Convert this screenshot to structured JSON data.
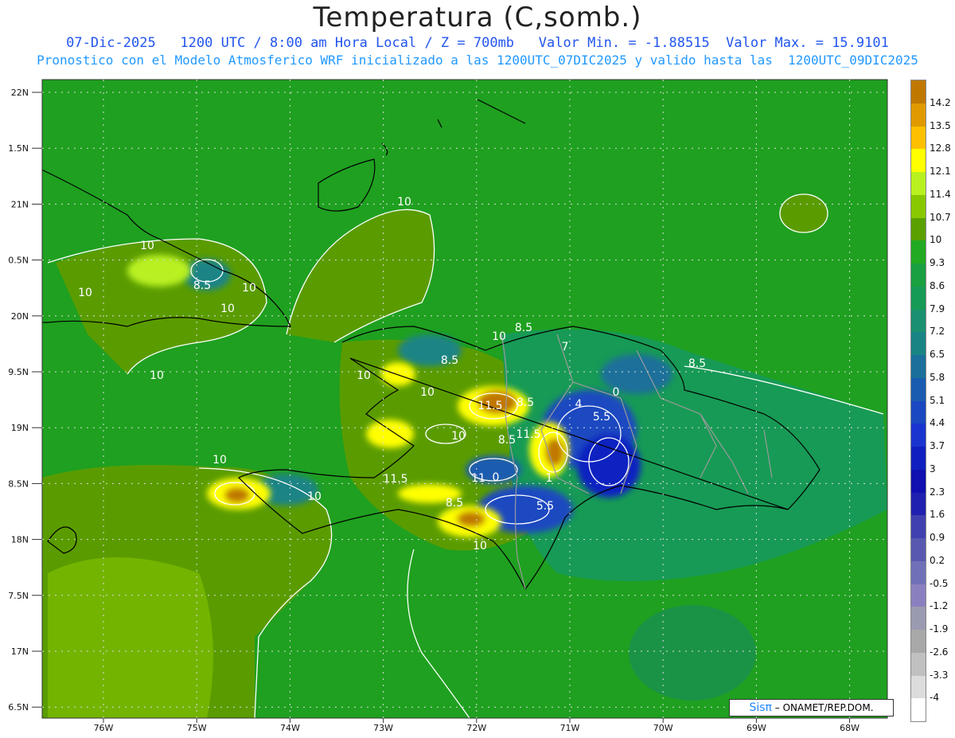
{
  "title": "Temperatura (C,somb.)",
  "subtitle1": "07-Dic-2025   1200 UTC / 8:00 am Hora Local / Z = 700mb   Valor Min. = -1.88515  Valor Max. = 15.9101",
  "subtitle2": "Pronostico con el Modelo Atmosferico WRF inicializado a las 1200UTC_07DIC2025 y valido hasta las  1200UTC_09DIC2025",
  "lat_labels": [
    "22N",
    "1.5N",
    "21N",
    "0.5N",
    "20N",
    "9.5N",
    "19N",
    "8.5N",
    "18N",
    "7.5N",
    "17N",
    "6.5N"
  ],
  "lon_labels": [
    "76W",
    "75W",
    "74W",
    "73W",
    "72W",
    "71W",
    "70W",
    "69W",
    "68W"
  ],
  "colorbar": {
    "labels": [
      "14.2",
      "13.5",
      "12.8",
      "12.1",
      "11.4",
      "10.7",
      "10",
      "9.3",
      "8.6",
      "7.9",
      "7.2",
      "6.5",
      "5.8",
      "5.1",
      "4.4",
      "3.7",
      "3",
      "2.3",
      "1.6",
      "0.9",
      "0.2",
      "-0.5",
      "-1.2",
      "-1.9",
      "-2.6",
      "-3.3",
      "-4"
    ],
    "colors": [
      "#c07800",
      "#e09a00",
      "#ffc000",
      "#ffff00",
      "#b8f020",
      "#88c800",
      "#5aa000",
      "#22aa22",
      "#1aa040",
      "#179a55",
      "#1a9070",
      "#1a8485",
      "#1a709a",
      "#1a5cb0",
      "#1a48c0",
      "#1a34d0",
      "#1020c0",
      "#1010b0",
      "#2020b0",
      "#4040b0",
      "#5858b0",
      "#7070b8",
      "#8a80c0",
      "#9a9ab0",
      "#a8a8a8",
      "#c0c0c0",
      "#dcdcdc",
      "#ffffff"
    ]
  },
  "contour_labels": [
    "10",
    "10",
    "10",
    "10",
    "10",
    "10",
    "10",
    "10",
    "10",
    "10",
    "10",
    "10",
    "10",
    "8.5",
    "8.5",
    "8.5",
    "8.5",
    "8.5",
    "8.5",
    "8.5",
    "11.5",
    "11.5",
    "11.5",
    "11",
    "7",
    "5.5",
    "5.5",
    "4",
    "0",
    "1",
    "0"
  ],
  "credit_logo": "Sisπ",
  "credit_text": "– ONAMET/REP.DOM."
}
